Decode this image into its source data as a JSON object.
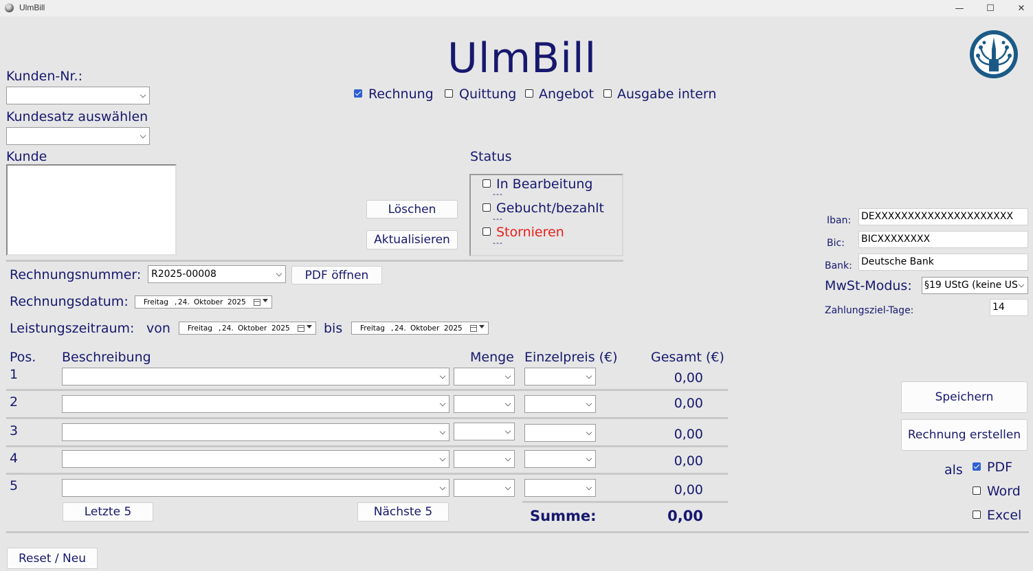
{
  "window": {
    "title": "UlmBill",
    "minimize": "—",
    "maximize": "☐",
    "close": "✕"
  },
  "app": {
    "title": "UlmBill"
  },
  "doc_types": [
    {
      "label": "Rechnung",
      "checked": true
    },
    {
      "label": "Quittung",
      "checked": false
    },
    {
      "label": "Angebot",
      "checked": false
    },
    {
      "label": "Ausgabe intern",
      "checked": false
    }
  ],
  "customer": {
    "number_label": "Kunden-Nr.:",
    "number_value": "",
    "record_label": "Kundesatz auswählen",
    "record_value": "",
    "customer_label": "Kunde",
    "customer_value": ""
  },
  "actions": {
    "delete": "Löschen",
    "refresh": "Aktualisieren"
  },
  "status": {
    "title": "Status",
    "items": [
      {
        "label": "In Bearbeitung",
        "checked": false,
        "sub": "---",
        "color": "#16186e"
      },
      {
        "label": "Gebucht/bezahlt",
        "checked": false,
        "sub": "---",
        "color": "#16186e"
      },
      {
        "label": "Stornieren",
        "checked": false,
        "sub": "---",
        "color": "#e8201c"
      }
    ]
  },
  "invoice": {
    "number_label": "Rechnungsnummer:",
    "number_value": "R2025-00008",
    "pdf_open": "PDF öffnen",
    "date_label": "Rechnungsdatum:",
    "period_label": "Leistungszeitraum:",
    "from_label": "von",
    "to_label": "bis",
    "date": {
      "day": "Freitag",
      "sep": ",",
      "dnum": "24.",
      "month": "Oktober",
      "year": "2025"
    }
  },
  "bank": {
    "iban_label": "Iban:",
    "iban_value": "DEXXXXXXXXXXXXXXXXXXXXX",
    "bic_label": "Bic:",
    "bic_value": "BICXXXXXXXX",
    "bank_label": "Bank:",
    "bank_value": "Deutsche Bank",
    "vat_label": "MwSt-Modus:",
    "vat_value": "§19 UStG (keine US",
    "due_label": "Zahlungsziel-Tage:",
    "due_value": "14"
  },
  "table": {
    "headers": {
      "pos": "Pos.",
      "desc": "Beschreibung",
      "qty": "Menge",
      "unit": "Einzelpreis (€)",
      "total": "Gesamt (€)"
    },
    "rows": [
      {
        "pos": "1",
        "total": "0,00"
      },
      {
        "pos": "2",
        "total": "0,00"
      },
      {
        "pos": "3",
        "total": "0,00"
      },
      {
        "pos": "4",
        "total": "0,00"
      },
      {
        "pos": "5",
        "total": "0,00"
      }
    ],
    "prev": "Letzte 5",
    "next": "Nächste 5",
    "sum_label": "Summe:",
    "sum_value": "0,00"
  },
  "right_actions": {
    "save": "Speichern",
    "create": "Rechnung erstellen",
    "as_label": "als"
  },
  "formats": [
    {
      "label": "PDF",
      "checked": true
    },
    {
      "label": "Word",
      "checked": false
    },
    {
      "label": "Excel",
      "checked": false
    }
  ],
  "reset": "Reset / Neu",
  "colors": {
    "primary": "#16186e",
    "background": "#e6e6e6",
    "storno": "#e8201c",
    "logo": "#1b5a86"
  }
}
